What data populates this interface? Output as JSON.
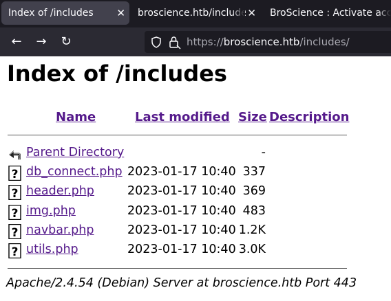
{
  "tabs": [
    {
      "title": "Index of /includes",
      "close": "✕"
    },
    {
      "title": "broscience.htb/includes/",
      "close": "✕"
    },
    {
      "title": "BroScience : Activate account",
      "close": ""
    }
  ],
  "nav": {
    "back": "←",
    "forward": "→",
    "reload": "↻"
  },
  "url": {
    "scheme": "https://",
    "host": "broscience.htb",
    "path": "/includes/"
  },
  "page": {
    "heading": "Index of /includes",
    "columns": {
      "name": "Name",
      "modified": "Last modified",
      "size": "Size",
      "description": "Description"
    },
    "entries": [
      {
        "name": "Parent Directory",
        "date": "",
        "size": "-",
        "icon": "back-arrow-icon"
      },
      {
        "name": "db_connect.php",
        "date": "2023-01-17 10:40",
        "size": "337",
        "icon": "unknown-file-icon"
      },
      {
        "name": "header.php",
        "date": "2023-01-17 10:40",
        "size": "369",
        "icon": "unknown-file-icon"
      },
      {
        "name": "img.php",
        "date": "2023-01-17 10:40",
        "size": "483",
        "icon": "unknown-file-icon"
      },
      {
        "name": "navbar.php",
        "date": "2023-01-17 10:40",
        "size": "1.2K",
        "icon": "unknown-file-icon"
      },
      {
        "name": "utils.php",
        "date": "2023-01-17 10:40",
        "size": "3.0K",
        "icon": "unknown-file-icon"
      }
    ],
    "footer": "Apache/2.4.54 (Debian) Server at broscience.htb Port 443"
  }
}
